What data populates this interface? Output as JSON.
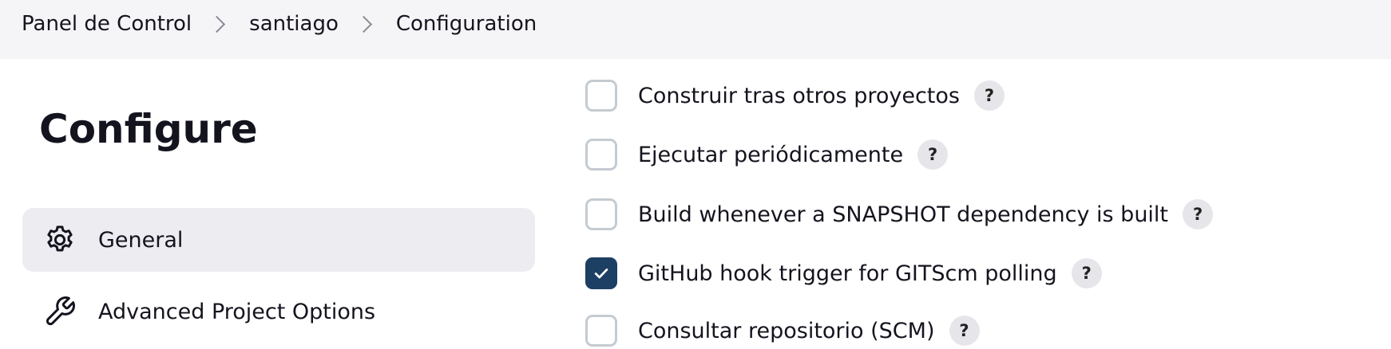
{
  "breadcrumb": [
    "Panel de Control",
    "santiago",
    "Configuration"
  ],
  "page": {
    "title": "Configure"
  },
  "sidebar": {
    "items": [
      {
        "label": "General",
        "icon": "gear-icon",
        "active": true
      },
      {
        "label": "Advanced Project Options",
        "icon": "wrench-icon",
        "active": false
      }
    ]
  },
  "triggers": [
    {
      "label": "Construir tras otros proyectos",
      "checked": false,
      "help": "?"
    },
    {
      "label": "Ejecutar periódicamente",
      "checked": false,
      "help": "?"
    },
    {
      "label": "Build whenever a SNAPSHOT dependency is built",
      "checked": false,
      "help": "?"
    },
    {
      "label": "GitHub hook trigger for GITScm polling",
      "checked": true,
      "help": "?"
    },
    {
      "label": "Consultar repositorio (SCM)",
      "checked": false,
      "help": "?"
    }
  ],
  "colors": {
    "checkbox_checked": "#1e3f64",
    "active_item_bg": "#ececf1",
    "topbar_bg": "#f5f5f7"
  }
}
